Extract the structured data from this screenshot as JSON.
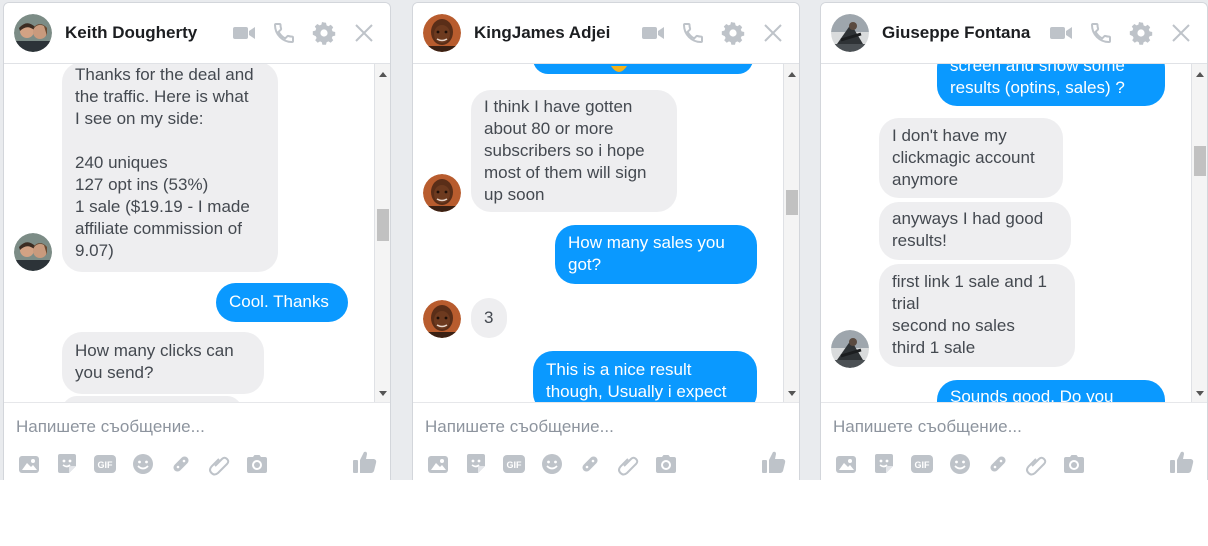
{
  "placeholder": "Напишете съобщение...",
  "gif_label": "GIF",
  "chats": [
    {
      "name": "Keith Dougherty",
      "messages": [
        {
          "dir": "in",
          "lines": [
            "Thanks for the deal and",
            "the traffic. Here is what",
            "I see on my side:",
            "",
            "240 uniques",
            "127 opt ins (53%)",
            "1 sale ($19.19 - I made",
            "affiliate commission of",
            "9.07)"
          ]
        },
        {
          "dir": "out",
          "lines": [
            "Cool. Thanks"
          ]
        },
        {
          "dir": "in",
          "lines": [
            "How many clicks can",
            "you send?"
          ]
        }
      ]
    },
    {
      "name": "KingJames Adjei",
      "messages": [
        {
          "dir": "in",
          "lines": [
            "I think I have gotten",
            "about 80 or more",
            "subscribers so i hope",
            "most of them will sign",
            "up soon"
          ]
        },
        {
          "dir": "out",
          "lines": [
            "How many sales you",
            "got?"
          ]
        },
        {
          "dir": "in",
          "lines": [
            "3"
          ]
        },
        {
          "dir": "out",
          "lines": [
            "This is a nice result",
            "though, Usually i expect"
          ]
        }
      ]
    },
    {
      "name": "Giuseppe Fontana",
      "messages": [
        {
          "dir": "out",
          "lines": [
            "screen and show some",
            "results (optins, sales) ?"
          ]
        },
        {
          "dir": "in",
          "lines": [
            "I don't have my",
            "clickmagic account",
            "anymore"
          ]
        },
        {
          "dir": "in",
          "lines": [
            "anyways I had good",
            "results!"
          ]
        },
        {
          "dir": "in",
          "lines": [
            "first link 1 sale and 1",
            "trial",
            "second no sales",
            "third 1 sale"
          ]
        },
        {
          "dir": "out",
          "lines": [
            "Sounds good. Do you"
          ]
        }
      ]
    }
  ],
  "colors": {
    "outgoing": "#0a99ff",
    "incoming": "#eeeef0",
    "icon": "#bec3c9"
  },
  "icons": {
    "header": [
      "video-call-icon",
      "voice-call-icon",
      "settings-gear-icon",
      "close-icon"
    ],
    "tools": [
      "photo-icon",
      "sticker-icon",
      "gif-icon",
      "emoji-icon",
      "game-icon",
      "attachment-icon",
      "camera-icon"
    ],
    "send": "thumbs-up-like-icon"
  }
}
